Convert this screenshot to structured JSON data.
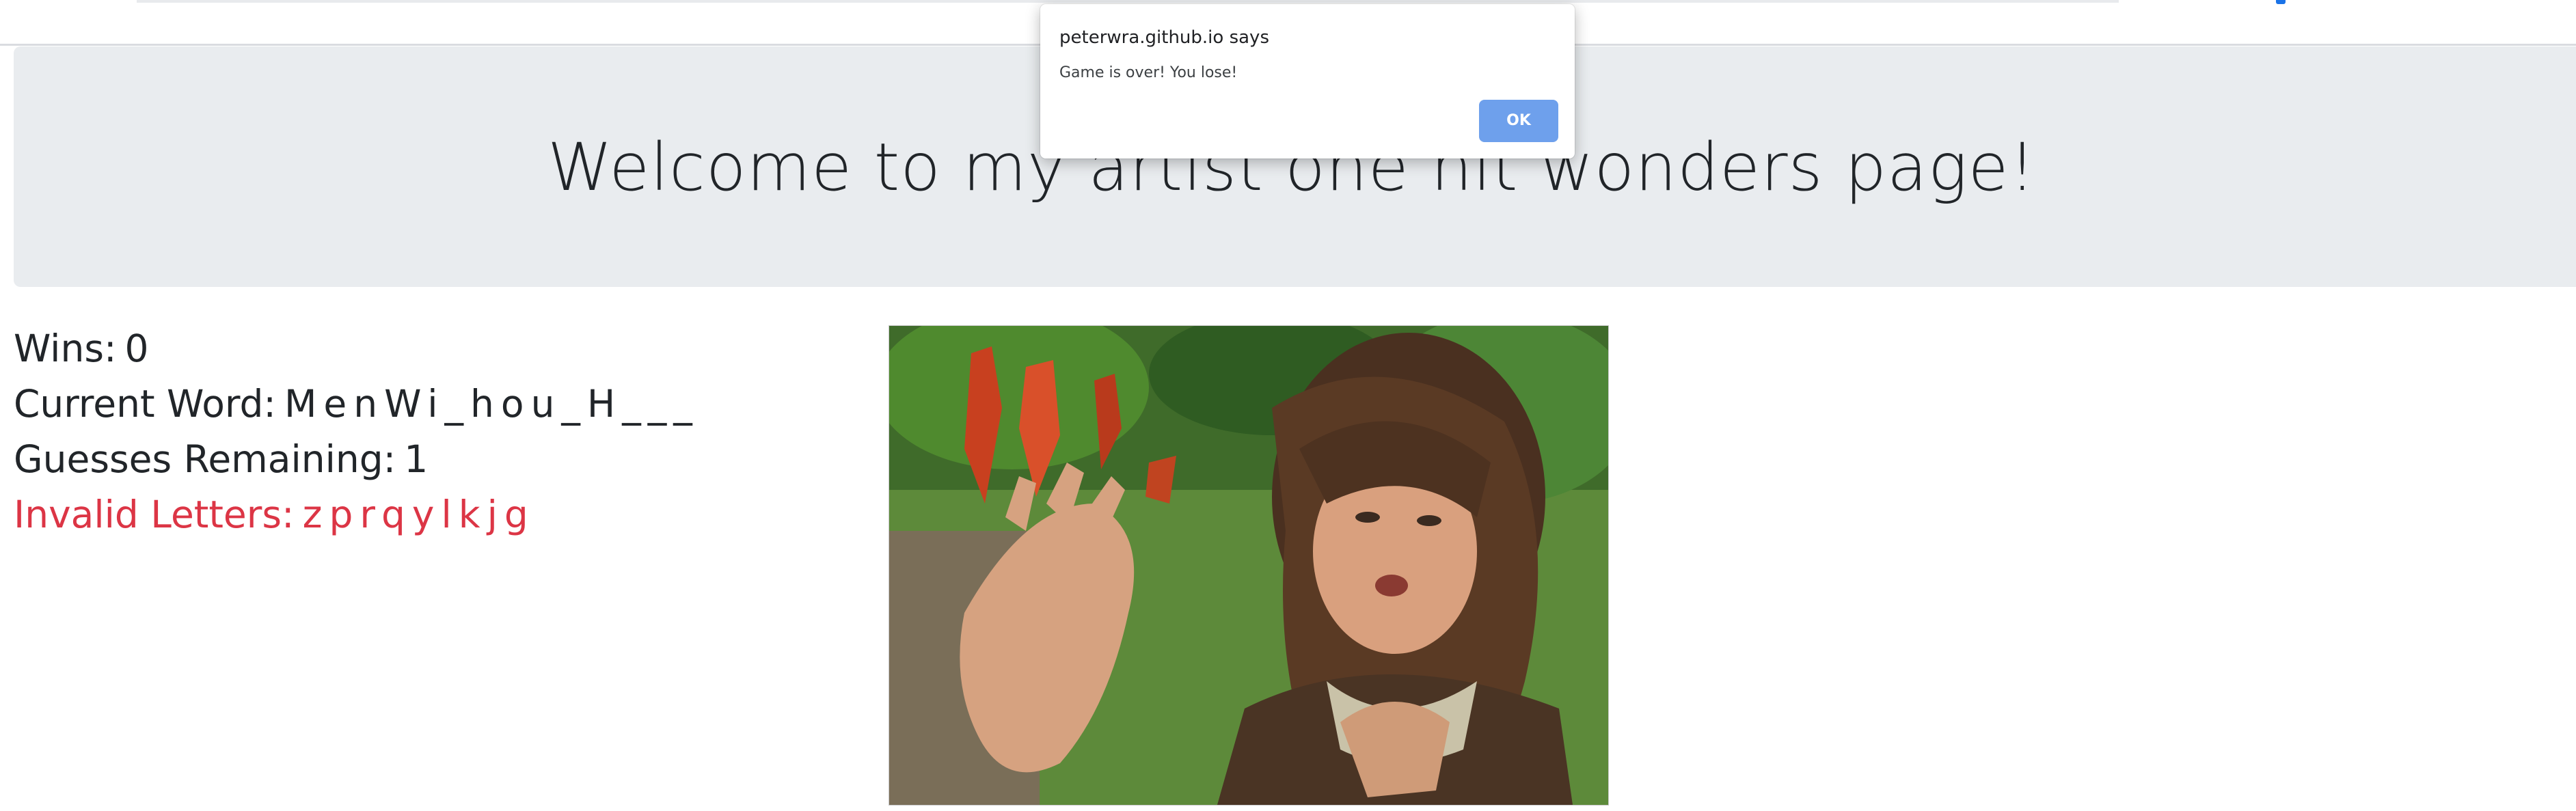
{
  "dialog": {
    "title": "peterwra.github.io says",
    "message": "Game is over! You lose!",
    "ok_label": "OK"
  },
  "jumbotron": {
    "title": "Welcome to my artist one hit wonders page!"
  },
  "game": {
    "wins_label": "Wins:",
    "wins_value": "0",
    "word_label": "Current Word:",
    "word_value": "MenWi_hou_H___",
    "guesses_label": "Guesses Remaining:",
    "guesses_value": "1",
    "invalid_label": "Invalid Letters:",
    "invalid_value": "zprqylkjg"
  },
  "colors": {
    "jumbotron_bg": "#e9ecef",
    "invalid_text": "#dc3545",
    "ok_button": "#6ea0ec"
  }
}
